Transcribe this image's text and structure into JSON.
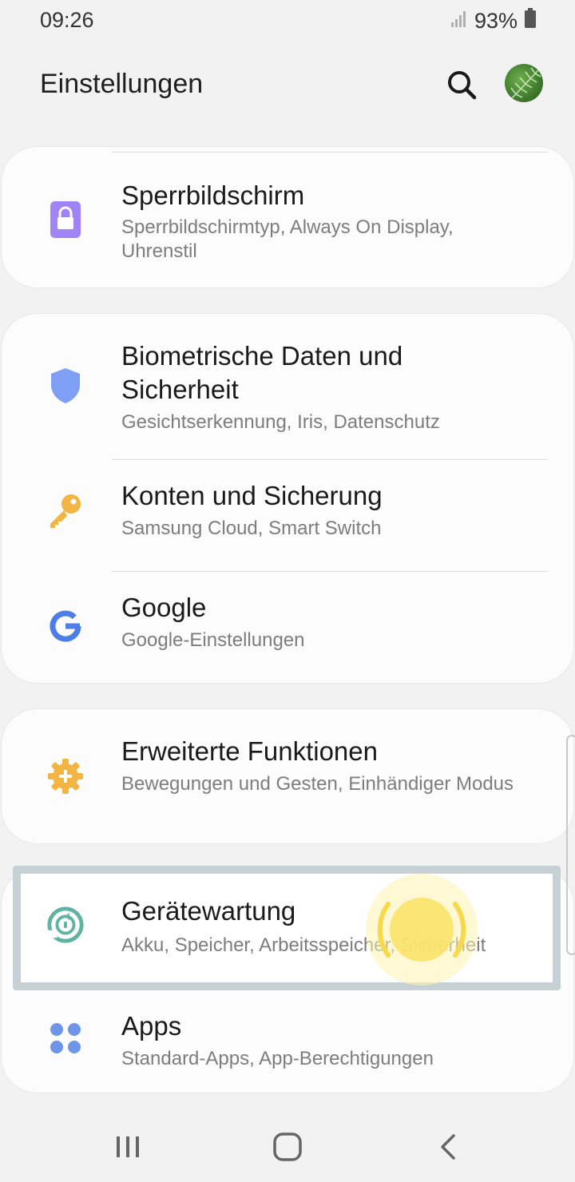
{
  "status": {
    "time": "09:26",
    "battery": "93%"
  },
  "header": {
    "title": "Einstellungen"
  },
  "items": [
    {
      "title": "Sperrbildschirm",
      "subtitle": "Sperrbildschirmtyp, Always On Display, Uhrenstil",
      "icon": "lock-icon",
      "color": "#a084f5"
    },
    {
      "title": "Biometrische Daten und Sicherheit",
      "subtitle": "Gesichtserkennung, Iris, Datenschutz",
      "icon": "shield-icon",
      "color": "#7f9ff5"
    },
    {
      "title": "Konten und Sicherung",
      "subtitle": "Samsung Cloud, Smart Switch",
      "icon": "key-icon",
      "color": "#f2b543"
    },
    {
      "title": "Google",
      "subtitle": "Google-Einstellungen",
      "icon": "google-icon",
      "color": "#4d7ee8"
    },
    {
      "title": "Erweiterte Funktionen",
      "subtitle": "Bewegungen und Gesten, Einhändiger Modus",
      "icon": "gear-plus-icon",
      "color": "#f2b543"
    },
    {
      "title": "Gerätewartung",
      "subtitle": "Akku, Speicher, Arbeitsspeicher, Sicherheit",
      "icon": "device-care-icon",
      "color": "#5fb3a3"
    },
    {
      "title": "Apps",
      "subtitle": "Standard-Apps, App-Berechtigungen",
      "icon": "apps-icon",
      "color": "#6e95e6"
    }
  ]
}
